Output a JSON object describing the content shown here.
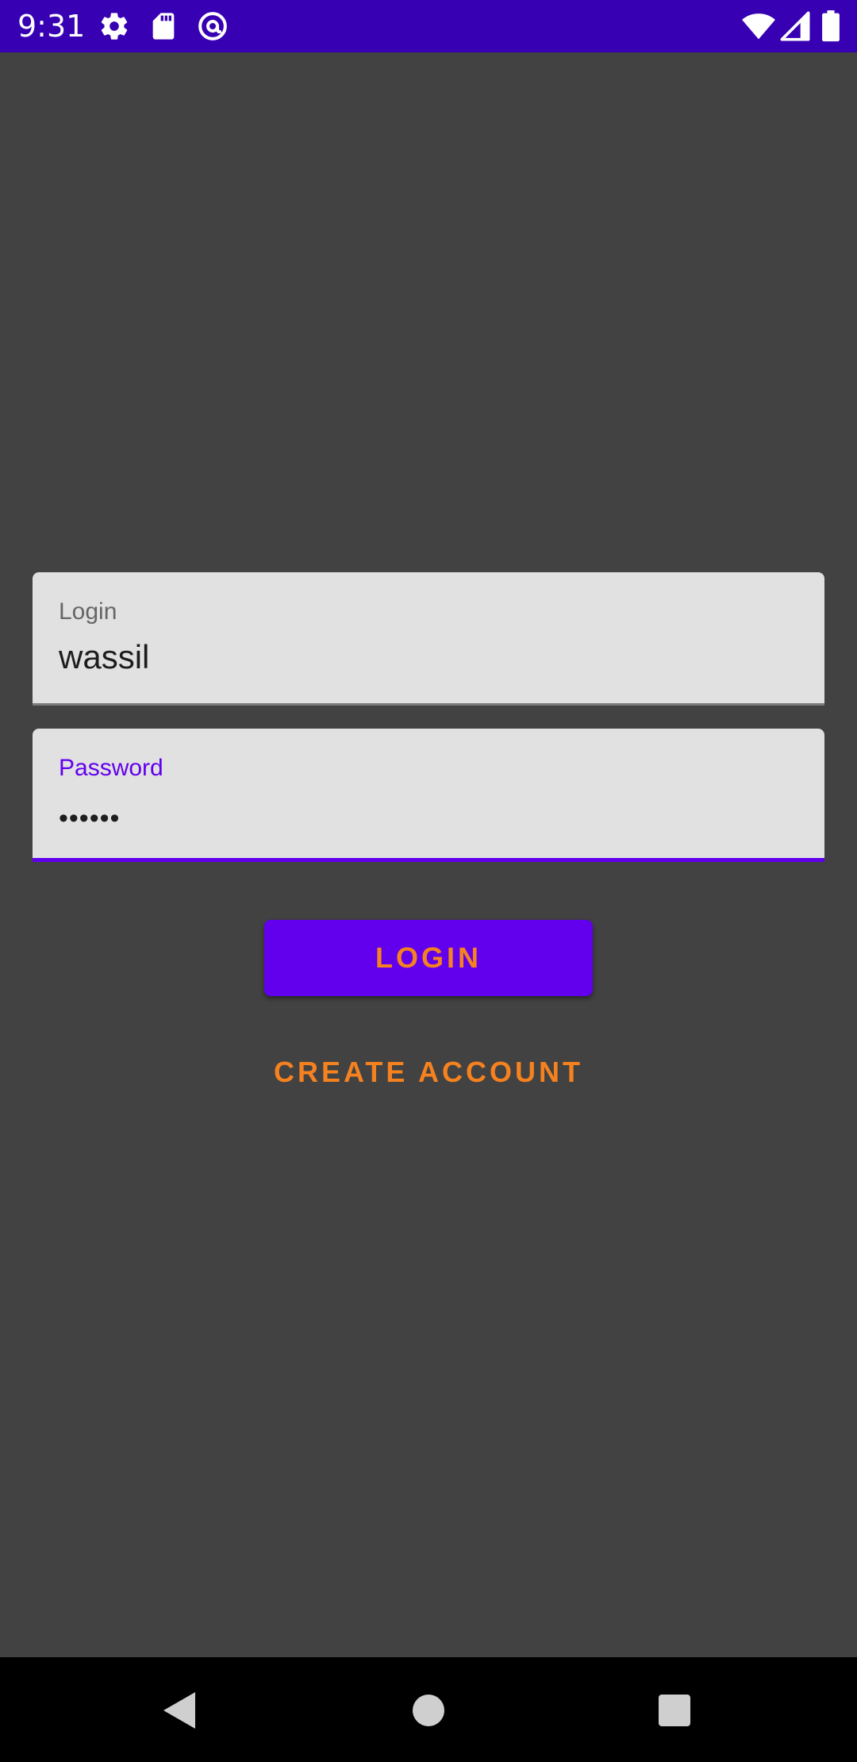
{
  "status_bar": {
    "time": "9:31",
    "background": "#3700B3",
    "left_icons": [
      "settings-icon",
      "sd-card-icon",
      "at-sign-icon"
    ],
    "right_icons": [
      "wifi-icon",
      "signal-icon",
      "battery-icon"
    ]
  },
  "form": {
    "login_field": {
      "label": "Login",
      "value": "wassil",
      "focused": false
    },
    "password_field": {
      "label": "Password",
      "value": "••••••",
      "focused": true
    },
    "login_button": "LOGIN",
    "create_account_button": "CREATE ACCOUNT"
  },
  "colors": {
    "primary": "#6200EE",
    "primary_dark": "#3700B3",
    "accent_text": "#F5821F",
    "background": "#424242",
    "field_background": "#E1E1E1"
  },
  "nav_bar": {
    "buttons": [
      "back-icon",
      "home-icon",
      "recents-icon"
    ]
  }
}
